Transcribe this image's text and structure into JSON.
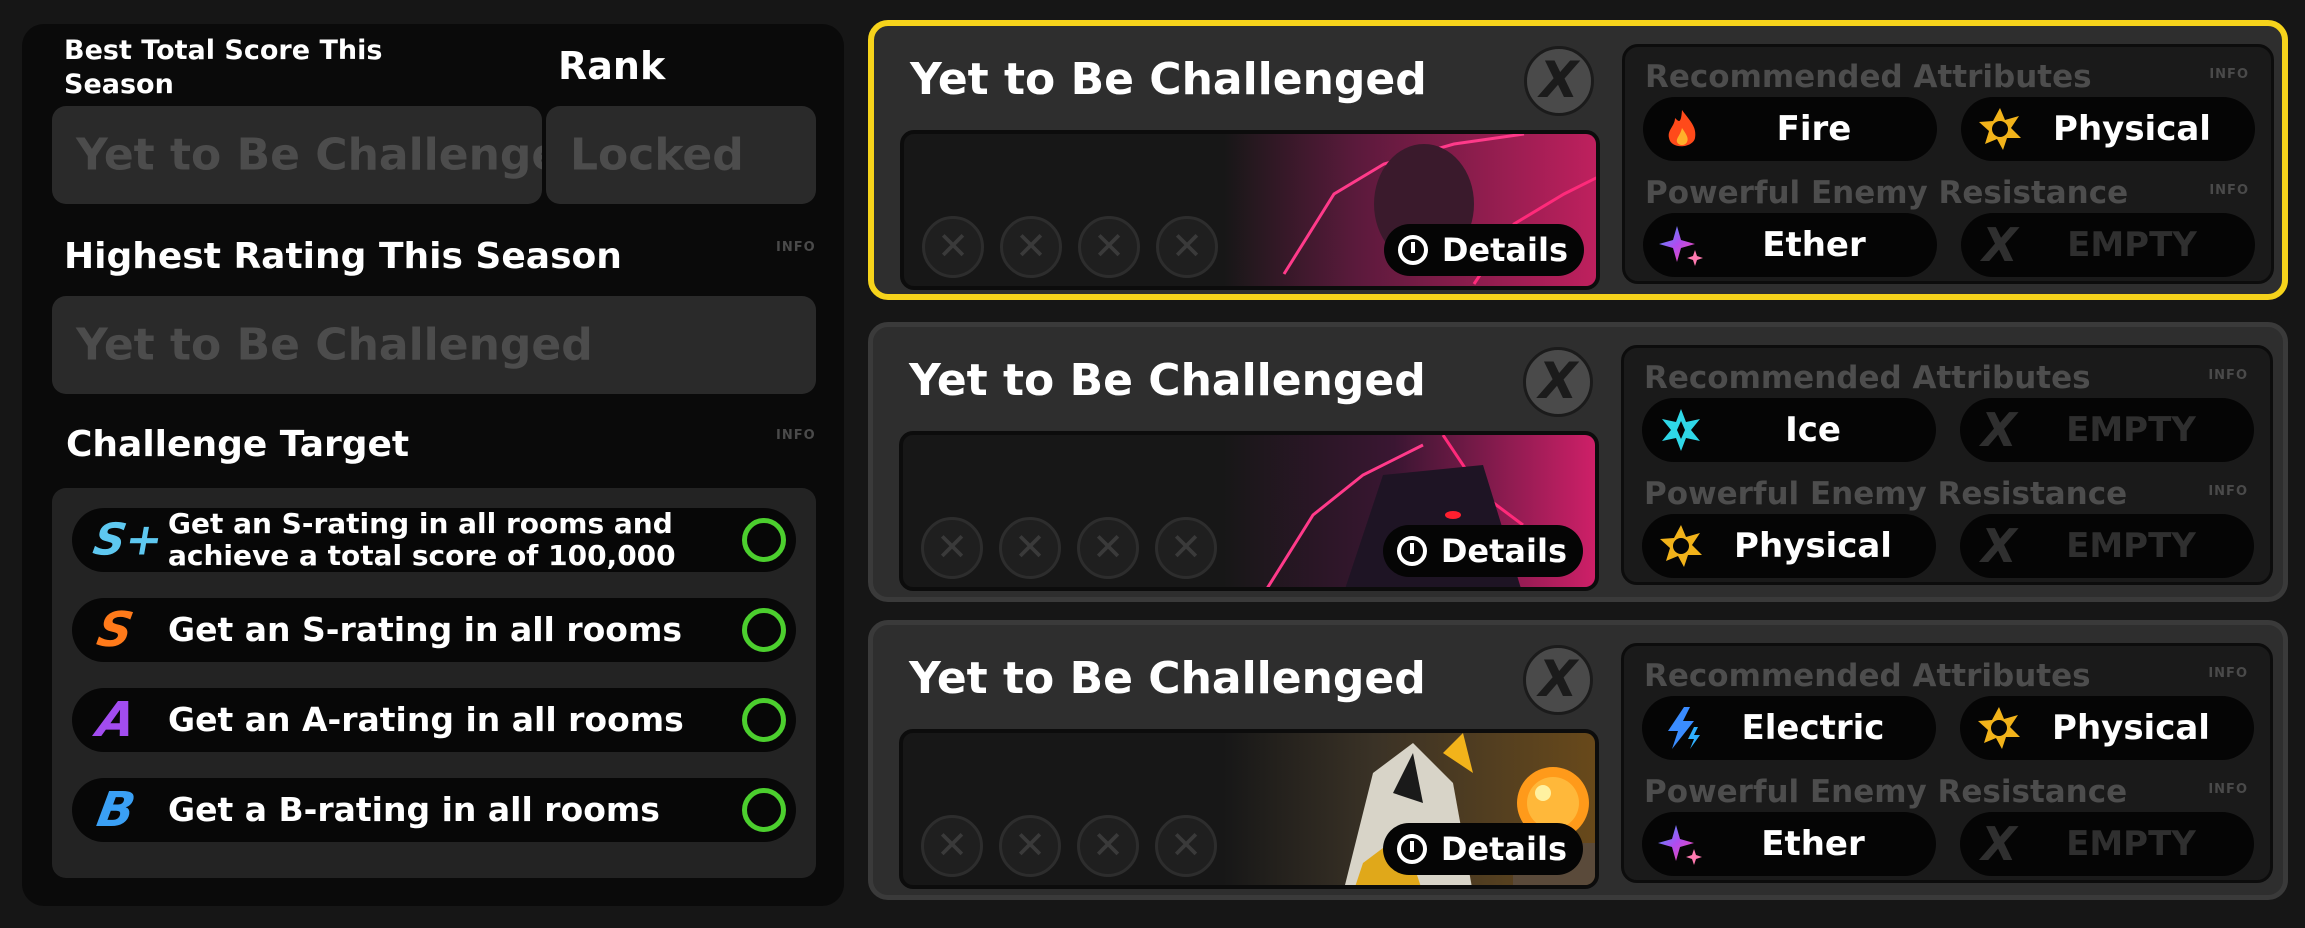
{
  "left_panel": {
    "best_score_label": "Best Total Score This Season",
    "best_score_value": "Yet to Be Challenged",
    "rank_label": "Rank",
    "rank_value": "Locked",
    "highest_rating_label": "Highest Rating This Season",
    "highest_rating_info": "INFO",
    "highest_rating_value": "Yet to Be Challenged",
    "challenge_target_label": "Challenge Target",
    "challenge_target_info": "INFO",
    "targets": [
      {
        "grade": "S+",
        "line1": "Get an S-rating in all rooms and",
        "line2": "achieve a total score of 100,000"
      },
      {
        "grade": "S",
        "text": "Get an S-rating in all rooms"
      },
      {
        "grade": "A",
        "text": "Get an A-rating in all rooms"
      },
      {
        "grade": "B",
        "text": "Get a B-rating in all rooms"
      }
    ]
  },
  "cards": [
    {
      "title": "Yet to Be Challenged",
      "close_glyph": "X",
      "details_label": "Details",
      "recommended_label": "Recommended Attributes",
      "resistance_label": "Powerful Enemy Resistance",
      "info": "INFO",
      "recommended": [
        {
          "name": "Fire",
          "icon": "fire-icon"
        },
        {
          "name": "Physical",
          "icon": "physical-icon"
        }
      ],
      "resistance": [
        {
          "name": "Ether",
          "icon": "ether-icon"
        },
        {
          "name": "EMPTY",
          "icon": "empty-icon"
        }
      ]
    },
    {
      "title": "Yet to Be Challenged",
      "close_glyph": "X",
      "details_label": "Details",
      "recommended_label": "Recommended Attributes",
      "resistance_label": "Powerful Enemy Resistance",
      "info": "INFO",
      "recommended": [
        {
          "name": "Ice",
          "icon": "ice-icon"
        },
        {
          "name": "EMPTY",
          "icon": "empty-icon"
        }
      ],
      "resistance": [
        {
          "name": "Physical",
          "icon": "physical-icon"
        },
        {
          "name": "EMPTY",
          "icon": "empty-icon"
        }
      ]
    },
    {
      "title": "Yet to Be Challenged",
      "close_glyph": "X",
      "details_label": "Details",
      "recommended_label": "Recommended Attributes",
      "resistance_label": "Powerful Enemy Resistance",
      "info": "INFO",
      "recommended": [
        {
          "name": "Electric",
          "icon": "electric-icon"
        },
        {
          "name": "Physical",
          "icon": "physical-icon"
        }
      ],
      "resistance": [
        {
          "name": "Ether",
          "icon": "ether-icon"
        },
        {
          "name": "EMPTY",
          "icon": "empty-icon"
        }
      ]
    }
  ],
  "colors": {
    "active_border": "#f6d31b",
    "ring": "#4ccf2e",
    "grade_splus": "#5ec8f0",
    "grade_s": "#ff7a1a",
    "grade_a": "#a24cf0",
    "grade_b": "#3aa0f5"
  }
}
